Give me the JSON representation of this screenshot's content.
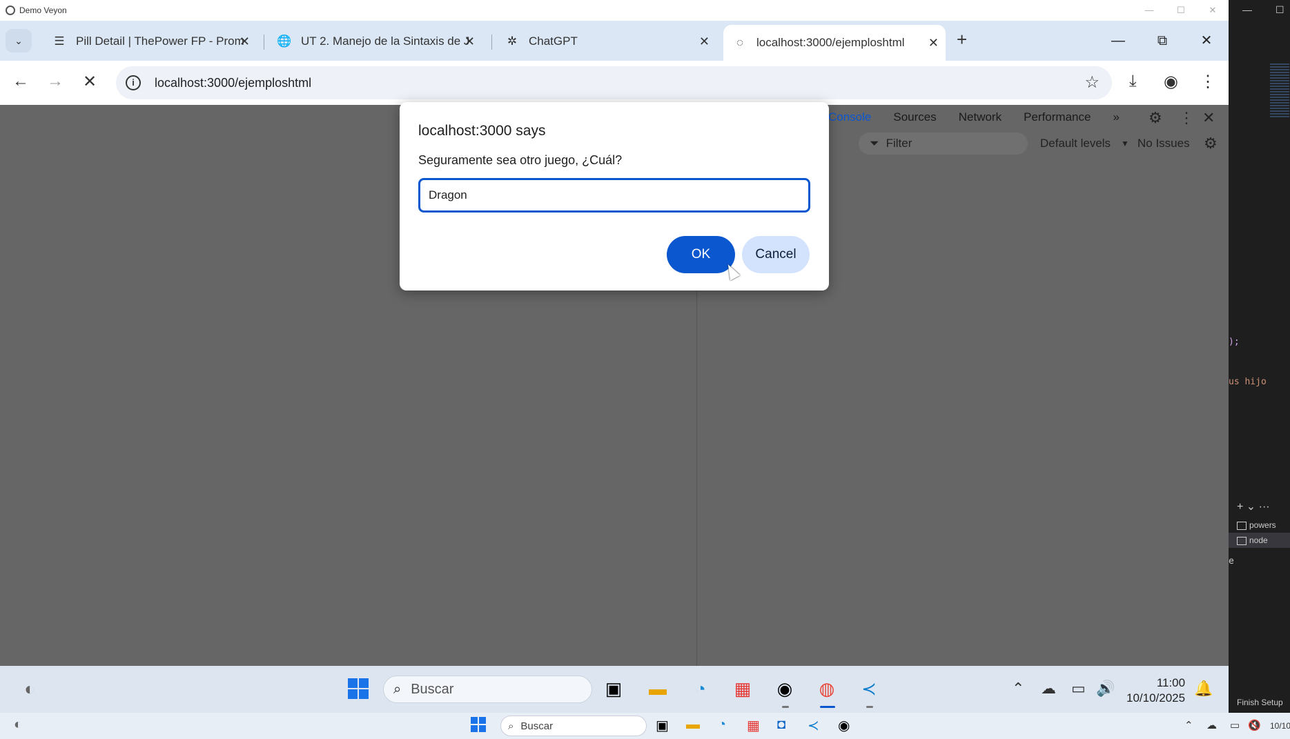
{
  "veyon": {
    "title": "Demo Veyon"
  },
  "browser": {
    "tabs": [
      {
        "label": "Pill Detail | ThePower FP - Prom",
        "icon": "lines-icon"
      },
      {
        "label": "UT 2. Manejo de la Sintaxis de J",
        "icon": "globe-icon"
      },
      {
        "label": "ChatGPT",
        "icon": "openai-icon"
      },
      {
        "label": "localhost:3000/ejemploshtml",
        "icon": "loading-icon"
      }
    ],
    "url": "localhost:3000/ejemploshtml"
  },
  "devtools": {
    "tabs": [
      "Console",
      "Sources",
      "Network",
      "Performance"
    ],
    "filter_placeholder": "Filter",
    "levels": "Default levels",
    "issues": "No Issues"
  },
  "dialog": {
    "title": "localhost:3000 says",
    "message": "Seguramente sea otro juego, ¿Cuál?",
    "input_value": "Dragon",
    "ok_label": "OK",
    "cancel_label": "Cancel"
  },
  "taskbar": {
    "search_placeholder": "Buscar",
    "time": "11:00",
    "date": "10/10/2025"
  },
  "host_taskbar": {
    "search_placeholder": "Buscar",
    "finish_setup": "Finish Setup",
    "date_partial": "10/10"
  },
  "editor": {
    "code_1": ");",
    "code_2": "us hijo",
    "terminal_items": [
      "powers",
      "node"
    ],
    "letter_e": "e"
  },
  "colors": {
    "accent": "#0b57d0",
    "dialog_bg": "#ffffff",
    "overlay": "#666666"
  }
}
